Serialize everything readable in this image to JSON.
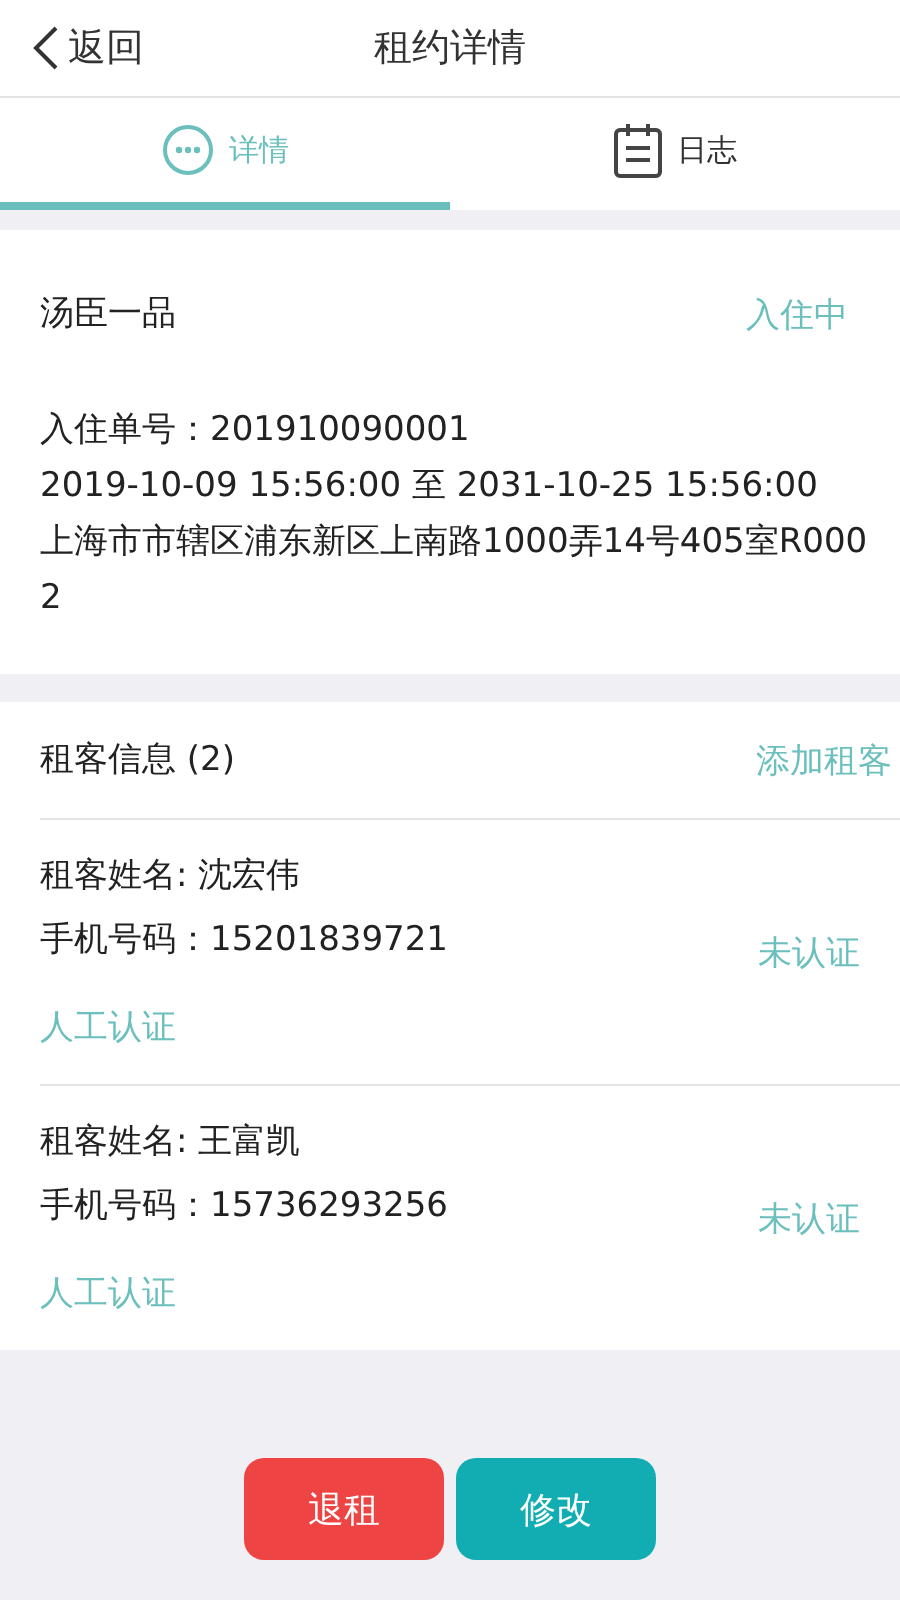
{
  "header": {
    "back": "返回",
    "title": "租约详情"
  },
  "tabs": [
    {
      "label": "详情",
      "kind": "dots",
      "selected": true
    },
    {
      "label": "日志",
      "kind": "calendar",
      "selected": false
    }
  ],
  "lease": {
    "name": "汤臣一品",
    "status": "入住中",
    "order": "入住单号：201910090001",
    "period": "2019-10-09 15:56:00 至 2031-10-25 15:56:00",
    "address": "上海市市辖区浦东新区上南路1000弄14号405室R0002"
  },
  "tenants_section": {
    "title": "租客信息 (2)",
    "action": "添加租客"
  },
  "tenants": [
    {
      "name": "租客姓名: 沈宏伟",
      "phone": "手机号码：15201839721",
      "status": "未认证",
      "action": "人工认证"
    },
    {
      "name": "租客姓名: 王富凯",
      "phone": "手机号码：15736293256",
      "status": "未认证",
      "action": "人工认证"
    }
  ],
  "buttons": [
    {
      "label": "退租",
      "kind": "danger"
    },
    {
      "label": "修改",
      "kind": "primary"
    }
  ]
}
